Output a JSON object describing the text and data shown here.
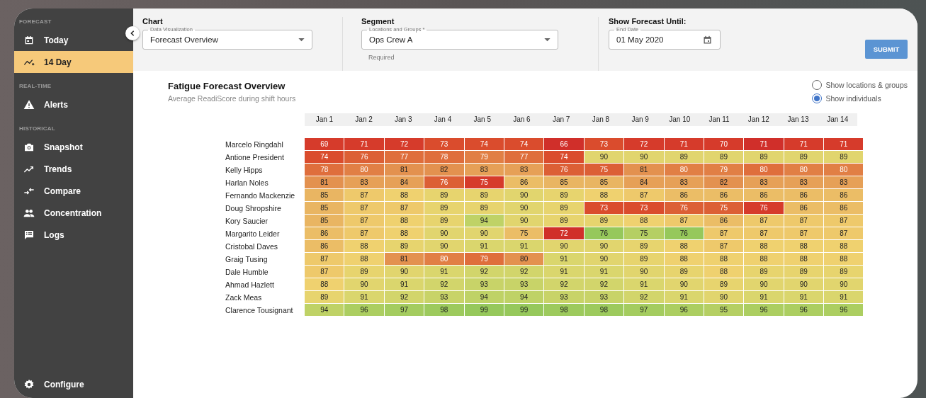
{
  "sidebar": {
    "sections": [
      {
        "heading": "FORECAST",
        "items": [
          {
            "label": "Today",
            "selected": false
          },
          {
            "label": "14 Day",
            "selected": true
          }
        ]
      },
      {
        "heading": "REAL-TIME",
        "items": [
          {
            "label": "Alerts",
            "selected": false
          }
        ]
      },
      {
        "heading": "HISTORICAL",
        "items": [
          {
            "label": "Snapshot",
            "selected": false
          },
          {
            "label": "Trends",
            "selected": false
          },
          {
            "label": "Compare",
            "selected": false
          },
          {
            "label": "Concentration",
            "selected": false
          },
          {
            "label": "Logs",
            "selected": false
          }
        ]
      }
    ],
    "footer": {
      "label": "Configure"
    }
  },
  "filters": [
    {
      "heading": "Chart",
      "kind": "select",
      "label": "Data Visualization",
      "value": "Forecast Overview"
    },
    {
      "heading": "Segment",
      "kind": "select",
      "label": "Locations and Groups *",
      "value": "Ops Crew A",
      "helper": "Required"
    },
    {
      "heading": "Show Forecast Until:",
      "kind": "date",
      "label": "End Date",
      "value": "01 May 2020"
    }
  ],
  "submit": "SUBMIT",
  "report": {
    "title": "Fatigue Forecast Overview",
    "subtitle": "Average ReadiScore during shift hours",
    "views": [
      {
        "label": "Show locations & groups",
        "selected": false
      },
      {
        "label": "Show individuals",
        "selected": true
      }
    ],
    "columns": [
      "Jan 1",
      "Jan 2",
      "Jan 3",
      "Jan 4",
      "Jan 5",
      "Jan 6",
      "Jan 7",
      "Jan 8",
      "Jan 9",
      "Jan 10",
      "Jan 11",
      "Jan 12",
      "Jan 13",
      "Jan 14"
    ],
    "rows": [
      {
        "name": "Marcelo Ringdahl",
        "cells": [
          {
            "value": "69",
            "color": "#d63b2b"
          },
          {
            "value": "71",
            "color": "#d63b2b"
          },
          {
            "value": "72",
            "color": "#d63b2b"
          },
          {
            "value": "73",
            "color": "#da4c2d"
          },
          {
            "value": "74",
            "color": "#da4c2d"
          },
          {
            "value": "74",
            "color": "#da4c2d"
          },
          {
            "value": "66",
            "color": "#d02f2a"
          },
          {
            "value": "73",
            "color": "#da4c2d"
          },
          {
            "value": "72",
            "color": "#d63b2b"
          },
          {
            "value": "71",
            "color": "#d63b2b"
          },
          {
            "value": "70",
            "color": "#d63b2b"
          },
          {
            "value": "71",
            "color": "#d02f2a"
          },
          {
            "value": "71",
            "color": "#d63b2b"
          },
          {
            "value": "71",
            "color": "#d63b2b"
          }
        ]
      },
      {
        "name": "Antione President",
        "cells": [
          {
            "value": "74",
            "color": "#da4c2d"
          },
          {
            "value": "76",
            "color": "#dc5f35"
          },
          {
            "value": "77",
            "color": "#df6e3c"
          },
          {
            "value": "78",
            "color": "#df6e3c"
          },
          {
            "value": "79",
            "color": "#e17f45"
          },
          {
            "value": "77",
            "color": "#df6e3c"
          },
          {
            "value": "74",
            "color": "#da4c2d"
          },
          {
            "value": "90",
            "color": "#e1d56e"
          },
          {
            "value": "90",
            "color": "#e1d56e"
          },
          {
            "value": "89",
            "color": "#e1d56e"
          },
          {
            "value": "89",
            "color": "#e1d56e"
          },
          {
            "value": "89",
            "color": "#e1d56e"
          },
          {
            "value": "89",
            "color": "#e1d56e"
          },
          {
            "value": "89",
            "color": "#e1d56e"
          }
        ]
      },
      {
        "name": "Kelly Hipps",
        "cells": [
          {
            "value": "78",
            "color": "#df6e3c"
          },
          {
            "value": "80",
            "color": "#e17f45"
          },
          {
            "value": "81",
            "color": "#e3914f"
          },
          {
            "value": "82",
            "color": "#e3914f"
          },
          {
            "value": "83",
            "color": "#e6a057"
          },
          {
            "value": "83",
            "color": "#e6a057"
          },
          {
            "value": "76",
            "color": "#dc5f35"
          },
          {
            "value": "75",
            "color": "#dc5f35"
          },
          {
            "value": "81",
            "color": "#e3914f"
          },
          {
            "value": "80",
            "color": "#e17f45"
          },
          {
            "value": "79",
            "color": "#e17f45"
          },
          {
            "value": "80",
            "color": "#df6e3c"
          },
          {
            "value": "80",
            "color": "#e17f45"
          },
          {
            "value": "80",
            "color": "#e17f45"
          }
        ]
      },
      {
        "name": "Harlan Noles",
        "cells": [
          {
            "value": "81",
            "color": "#e3914f"
          },
          {
            "value": "83",
            "color": "#e6a057"
          },
          {
            "value": "84",
            "color": "#e6a057"
          },
          {
            "value": "76",
            "color": "#dc5f35"
          },
          {
            "value": "75",
            "color": "#d63b2b"
          },
          {
            "value": "86",
            "color": "#ebbd66"
          },
          {
            "value": "85",
            "color": "#e9b562"
          },
          {
            "value": "85",
            "color": "#e9b562"
          },
          {
            "value": "84",
            "color": "#e6a057"
          },
          {
            "value": "83",
            "color": "#e6a057"
          },
          {
            "value": "82",
            "color": "#e3914f"
          },
          {
            "value": "83",
            "color": "#e6a057"
          },
          {
            "value": "83",
            "color": "#e6a057"
          },
          {
            "value": "83",
            "color": "#e6a057"
          }
        ]
      },
      {
        "name": "Fernando Mackenzie",
        "cells": [
          {
            "value": "85",
            "color": "#e9b562"
          },
          {
            "value": "87",
            "color": "#eec96b"
          },
          {
            "value": "88",
            "color": "#efd16f"
          },
          {
            "value": "89",
            "color": "#e7d46e"
          },
          {
            "value": "89",
            "color": "#e7d46e"
          },
          {
            "value": "90",
            "color": "#e1d56e"
          },
          {
            "value": "89",
            "color": "#e7d46e"
          },
          {
            "value": "88",
            "color": "#efd16f"
          },
          {
            "value": "87",
            "color": "#eec96b"
          },
          {
            "value": "86",
            "color": "#ebbd66"
          },
          {
            "value": "86",
            "color": "#ebbd66"
          },
          {
            "value": "86",
            "color": "#ebbd66"
          },
          {
            "value": "86",
            "color": "#ebbd66"
          },
          {
            "value": "86",
            "color": "#ebbd66"
          }
        ]
      },
      {
        "name": "Doug Shropshire",
        "cells": [
          {
            "value": "85",
            "color": "#e9b562"
          },
          {
            "value": "87",
            "color": "#eec96b"
          },
          {
            "value": "87",
            "color": "#eec96b"
          },
          {
            "value": "89",
            "color": "#e7d46e"
          },
          {
            "value": "89",
            "color": "#e7d46e"
          },
          {
            "value": "90",
            "color": "#e1d56e"
          },
          {
            "value": "89",
            "color": "#e7d46e"
          },
          {
            "value": "73",
            "color": "#da4c2d"
          },
          {
            "value": "73",
            "color": "#da4c2d"
          },
          {
            "value": "76",
            "color": "#dc5f35"
          },
          {
            "value": "75",
            "color": "#dc5f35"
          },
          {
            "value": "76",
            "color": "#d63b2b"
          },
          {
            "value": "86",
            "color": "#ebbd66"
          },
          {
            "value": "86",
            "color": "#ebbd66"
          }
        ]
      },
      {
        "name": "Kory Saucier",
        "cells": [
          {
            "value": "85",
            "color": "#e9b562"
          },
          {
            "value": "87",
            "color": "#eec96b"
          },
          {
            "value": "88",
            "color": "#efd16f"
          },
          {
            "value": "89",
            "color": "#e7d46e"
          },
          {
            "value": "94",
            "color": "#bfd266"
          },
          {
            "value": "90",
            "color": "#e1d56e"
          },
          {
            "value": "89",
            "color": "#e7d46e"
          },
          {
            "value": "89",
            "color": "#e7d46e"
          },
          {
            "value": "88",
            "color": "#efd16f"
          },
          {
            "value": "87",
            "color": "#eec96b"
          },
          {
            "value": "86",
            "color": "#ebbd66"
          },
          {
            "value": "87",
            "color": "#eec96b"
          },
          {
            "value": "87",
            "color": "#eec96b"
          },
          {
            "value": "87",
            "color": "#eec96b"
          }
        ]
      },
      {
        "name": "Margarito Leider",
        "cells": [
          {
            "value": "86",
            "color": "#ebbd66"
          },
          {
            "value": "87",
            "color": "#eec96b"
          },
          {
            "value": "88",
            "color": "#efd16f"
          },
          {
            "value": "90",
            "color": "#e1d56e"
          },
          {
            "value": "90",
            "color": "#e1d56e"
          },
          {
            "value": "75",
            "color": "#ebbd66"
          },
          {
            "value": "72",
            "color": "#d02f2a"
          },
          {
            "value": "76",
            "color": "#96c85b"
          },
          {
            "value": "75",
            "color": "#b5cf63"
          },
          {
            "value": "76",
            "color": "#96c85b"
          },
          {
            "value": "87",
            "color": "#eec96b"
          },
          {
            "value": "87",
            "color": "#eec96b"
          },
          {
            "value": "87",
            "color": "#eec96b"
          },
          {
            "value": "87",
            "color": "#eec96b"
          }
        ]
      },
      {
        "name": "Cristobal Daves",
        "cells": [
          {
            "value": "86",
            "color": "#ebbd66"
          },
          {
            "value": "88",
            "color": "#efd16f"
          },
          {
            "value": "89",
            "color": "#e7d46e"
          },
          {
            "value": "90",
            "color": "#e1d56e"
          },
          {
            "value": "91",
            "color": "#dad66d"
          },
          {
            "value": "91",
            "color": "#dad66d"
          },
          {
            "value": "90",
            "color": "#e1d56e"
          },
          {
            "value": "90",
            "color": "#e1d56e"
          },
          {
            "value": "89",
            "color": "#e7d46e"
          },
          {
            "value": "88",
            "color": "#efd16f"
          },
          {
            "value": "87",
            "color": "#eec96b"
          },
          {
            "value": "88",
            "color": "#efd16f"
          },
          {
            "value": "88",
            "color": "#efd16f"
          },
          {
            "value": "88",
            "color": "#efd16f"
          }
        ]
      },
      {
        "name": "Graig Tusing",
        "cells": [
          {
            "value": "87",
            "color": "#eec96b"
          },
          {
            "value": "88",
            "color": "#efd16f"
          },
          {
            "value": "81",
            "color": "#e3914f"
          },
          {
            "value": "80",
            "color": "#e17f45"
          },
          {
            "value": "79",
            "color": "#df6e3c"
          },
          {
            "value": "80",
            "color": "#e3914f"
          },
          {
            "value": "91",
            "color": "#dad66d"
          },
          {
            "value": "90",
            "color": "#e1d56e"
          },
          {
            "value": "89",
            "color": "#e7d46e"
          },
          {
            "value": "88",
            "color": "#efd16f"
          },
          {
            "value": "88",
            "color": "#efd16f"
          },
          {
            "value": "88",
            "color": "#efd16f"
          },
          {
            "value": "88",
            "color": "#efd16f"
          },
          {
            "value": "88",
            "color": "#efd16f"
          }
        ]
      },
      {
        "name": "Dale Humble",
        "cells": [
          {
            "value": "87",
            "color": "#eec96b"
          },
          {
            "value": "89",
            "color": "#e7d46e"
          },
          {
            "value": "90",
            "color": "#e1d56e"
          },
          {
            "value": "91",
            "color": "#dad66d"
          },
          {
            "value": "92",
            "color": "#d2d56b"
          },
          {
            "value": "92",
            "color": "#d2d56b"
          },
          {
            "value": "91",
            "color": "#dad66d"
          },
          {
            "value": "91",
            "color": "#dad66d"
          },
          {
            "value": "90",
            "color": "#e1d56e"
          },
          {
            "value": "89",
            "color": "#e7d46e"
          },
          {
            "value": "88",
            "color": "#efd16f"
          },
          {
            "value": "89",
            "color": "#e7d46e"
          },
          {
            "value": "89",
            "color": "#e7d46e"
          },
          {
            "value": "89",
            "color": "#e7d46e"
          }
        ]
      },
      {
        "name": "Ahmad Hazlett",
        "cells": [
          {
            "value": "88",
            "color": "#efd16f"
          },
          {
            "value": "90",
            "color": "#e1d56e"
          },
          {
            "value": "91",
            "color": "#dad66d"
          },
          {
            "value": "92",
            "color": "#d2d56b"
          },
          {
            "value": "93",
            "color": "#c8d368"
          },
          {
            "value": "93",
            "color": "#c8d368"
          },
          {
            "value": "92",
            "color": "#d2d56b"
          },
          {
            "value": "92",
            "color": "#d2d56b"
          },
          {
            "value": "91",
            "color": "#dad66d"
          },
          {
            "value": "90",
            "color": "#e1d56e"
          },
          {
            "value": "89",
            "color": "#e7d46e"
          },
          {
            "value": "90",
            "color": "#e1d56e"
          },
          {
            "value": "90",
            "color": "#e1d56e"
          },
          {
            "value": "90",
            "color": "#e1d56e"
          }
        ]
      },
      {
        "name": "Zack Meas",
        "cells": [
          {
            "value": "89",
            "color": "#e7d46e"
          },
          {
            "value": "91",
            "color": "#dad66d"
          },
          {
            "value": "92",
            "color": "#d2d56b"
          },
          {
            "value": "93",
            "color": "#c8d368"
          },
          {
            "value": "94",
            "color": "#bfd266"
          },
          {
            "value": "94",
            "color": "#bfd266"
          },
          {
            "value": "93",
            "color": "#c8d368"
          },
          {
            "value": "93",
            "color": "#c8d368"
          },
          {
            "value": "92",
            "color": "#d2d56b"
          },
          {
            "value": "91",
            "color": "#dad66d"
          },
          {
            "value": "90",
            "color": "#e1d56e"
          },
          {
            "value": "91",
            "color": "#dad66d"
          },
          {
            "value": "91",
            "color": "#dad66d"
          },
          {
            "value": "91",
            "color": "#dad66d"
          }
        ]
      },
      {
        "name": "Clarence Tousignant",
        "cells": [
          {
            "value": "94",
            "color": "#bfd266"
          },
          {
            "value": "96",
            "color": "#acce61"
          },
          {
            "value": "97",
            "color": "#a4cc5f"
          },
          {
            "value": "98",
            "color": "#9dca5d"
          },
          {
            "value": "99",
            "color": "#96c85b"
          },
          {
            "value": "99",
            "color": "#96c85b"
          },
          {
            "value": "98",
            "color": "#9dca5d"
          },
          {
            "value": "98",
            "color": "#9dca5d"
          },
          {
            "value": "97",
            "color": "#a4cc5f"
          },
          {
            "value": "96",
            "color": "#acce61"
          },
          {
            "value": "95",
            "color": "#b5cf63"
          },
          {
            "value": "96",
            "color": "#acce61"
          },
          {
            "value": "96",
            "color": "#acce61"
          },
          {
            "value": "96",
            "color": "#acce61"
          }
        ]
      }
    ]
  }
}
